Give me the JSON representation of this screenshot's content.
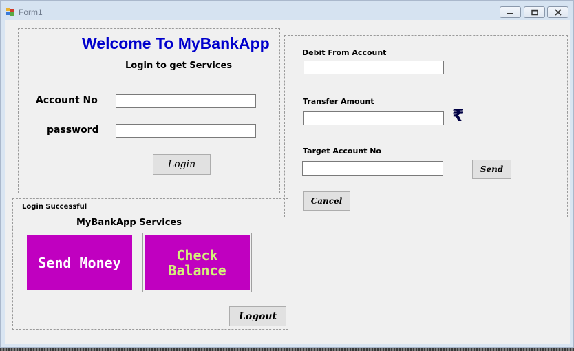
{
  "window": {
    "title": "Form1",
    "accent": "#0000cc",
    "controls": [
      "minimize-icon",
      "restore-icon",
      "close-icon"
    ]
  },
  "login": {
    "heading": "Welcome To MyBankApp",
    "subheading": "Login to get Services",
    "account_label": "Account No",
    "account_value": "",
    "password_label": "password",
    "password_value": "",
    "login_button": "Login"
  },
  "services": {
    "status": "Login Successful",
    "title": "MyBankApp Services",
    "tile_color": "#c000c0",
    "send_money": "Send Money",
    "check_balance": "Check Balance",
    "check_balance_color": "#d4f07a",
    "logout_button": "Logout"
  },
  "transfer": {
    "debit_label": "Debit From Account",
    "debit_value": "",
    "amount_label": "Transfer Amount",
    "amount_value": "",
    "currency_symbol": "₹",
    "target_label": "Target Account No",
    "target_value": "",
    "send_button": "Send",
    "cancel_button": "Cancel"
  }
}
